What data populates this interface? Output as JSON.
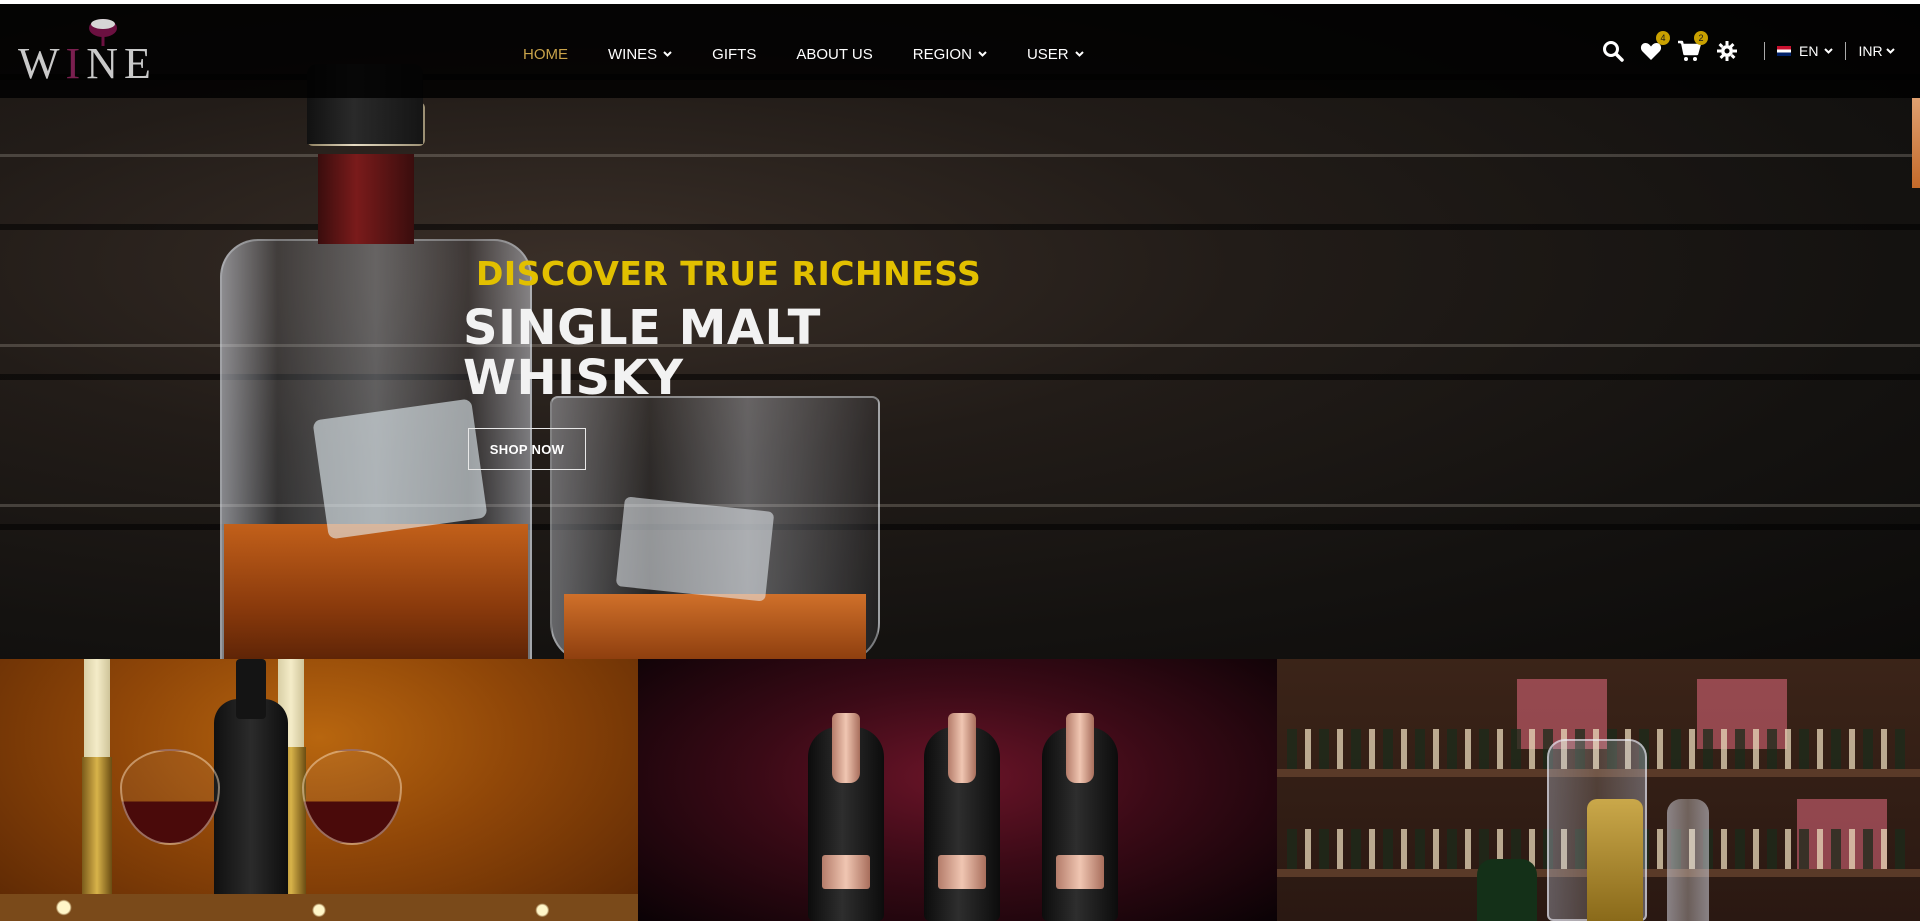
{
  "brand": {
    "logo_text_w": "W",
    "logo_text_i": "I",
    "logo_text_ne": "NE"
  },
  "nav": {
    "items": [
      {
        "label": "HOME",
        "active": true,
        "has_dropdown": false
      },
      {
        "label": "WINES",
        "active": false,
        "has_dropdown": true
      },
      {
        "label": "GIFTS",
        "active": false,
        "has_dropdown": false
      },
      {
        "label": "ABOUT US",
        "active": false,
        "has_dropdown": false
      },
      {
        "label": "REGION",
        "active": false,
        "has_dropdown": true
      },
      {
        "label": "USER",
        "active": false,
        "has_dropdown": true
      }
    ],
    "caret_glyph": "❯"
  },
  "tools": {
    "wishlist_count": "4",
    "cart_count": "2",
    "language": "EN",
    "currency": "INR",
    "icons": [
      "search-icon",
      "heart-icon",
      "cart-icon",
      "gear-icon",
      "flag-icon"
    ]
  },
  "hero": {
    "kicker": "DISCOVER TRUE RICHNESS",
    "title_line1": "SINGLE MALT",
    "title_line2": "WHISKY",
    "cta_label": "SHOP NOW"
  },
  "colors": {
    "active_nav": "#c9a34a",
    "kicker": "#e2c000",
    "badge": "#c9a100"
  }
}
